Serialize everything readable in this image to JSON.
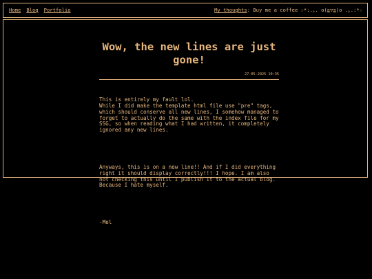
{
  "nav": {
    "home": "Home",
    "blog": "Blog",
    "portfolio": "Portfolio"
  },
  "thoughts": {
    "link": "My thoughts",
    "text": ": Buy me a coffee ☆*:.｡. o(≧▽≦)o .｡.:*☆"
  },
  "post": {
    "title": "Wow, the new lines are just gone!",
    "date": "27-05-2025 10:35",
    "paragraphs": [
      "This is entirely my fault lol.\nWhile I did make the template html file use \"pre\" tags,\nwhich should conserve all new lines, I somehow managed to\nforget to actually do the same with the index file for my\nSSG, so when reading what I had written, it completely\nignored any new lines.",
      "Anyways, this is on a new line!! And if I did everything\nright it should display correctly!!! I hope. I am also\nnot checking this until I publish it to the actual blog.\nBecause I hate myself.",
      "-Mel"
    ]
  },
  "colors": {
    "accent": "#e8b77e",
    "background": "#000000"
  }
}
